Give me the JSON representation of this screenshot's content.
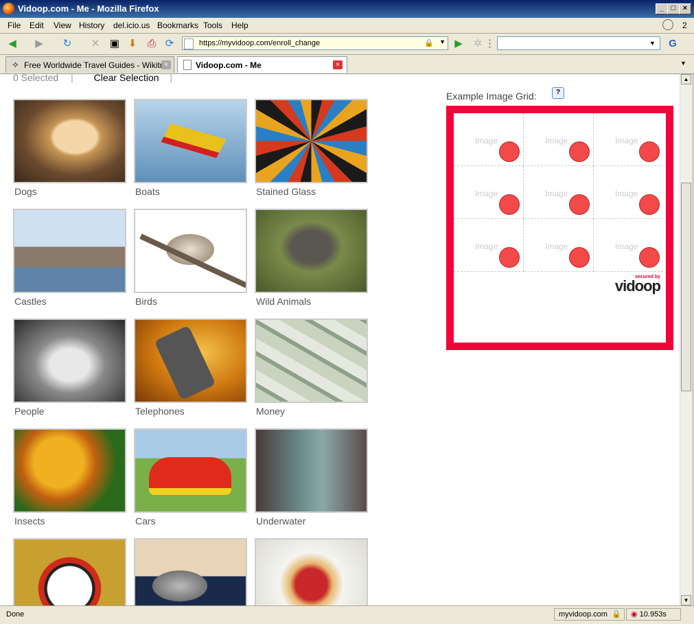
{
  "window": {
    "title": "Vidoop.com - Me - Mozilla Firefox"
  },
  "menu": {
    "items": [
      "File",
      "Edit",
      "View",
      "History",
      "del.icio.us",
      "Bookmarks",
      "Tools",
      "Help"
    ],
    "count_badge": "2"
  },
  "nav": {
    "url": "https://myvidoop.com/enroll_change",
    "search_value": ""
  },
  "tabs": [
    {
      "label": "Free Worldwide Travel Guides - Wikitr...",
      "active": false
    },
    {
      "label": "Vidoop.com - Me",
      "active": true
    }
  ],
  "selection": {
    "count_text": "0 Selected",
    "clear_label": "Clear Selection"
  },
  "categories": [
    "Dogs",
    "Boats",
    "Stained Glass",
    "Castles",
    "Birds",
    "Wild Animals",
    "People",
    "Telephones",
    "Money",
    "Insects",
    "Cars",
    "Underwater",
    "",
    "",
    ""
  ],
  "example": {
    "label": "Example Image Grid:",
    "help_glyph": "?",
    "cell_label": "Image",
    "secured_small": "secured by",
    "secured_brand": "vidoop"
  },
  "status": {
    "text": "Done",
    "domain": "myvidoop.com",
    "timer": "10.953s"
  },
  "colors": {
    "grid_border": "#f5003a",
    "dot": "#f44949",
    "accent": "#0a246a"
  }
}
